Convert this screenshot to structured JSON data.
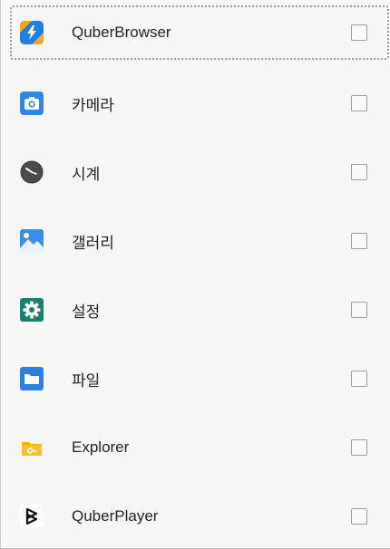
{
  "apps": [
    {
      "label": "QuberBrowser",
      "icon": "quberbrowser-icon",
      "checked": false,
      "focused": true
    },
    {
      "label": "카메라",
      "icon": "camera-icon",
      "checked": false
    },
    {
      "label": "시계",
      "icon": "clock-icon",
      "checked": false
    },
    {
      "label": "갤러리",
      "icon": "gallery-icon",
      "checked": false
    },
    {
      "label": "설정",
      "icon": "settings-icon",
      "checked": false
    },
    {
      "label": "파일",
      "icon": "files-icon",
      "checked": false
    },
    {
      "label": "Explorer",
      "icon": "explorer-icon",
      "checked": false
    },
    {
      "label": "QuberPlayer",
      "icon": "quberplayer-icon",
      "checked": false
    }
  ],
  "colors": {
    "background": "#f7f7f7",
    "checkbox_border": "#9b9b9b",
    "text": "#222222"
  }
}
